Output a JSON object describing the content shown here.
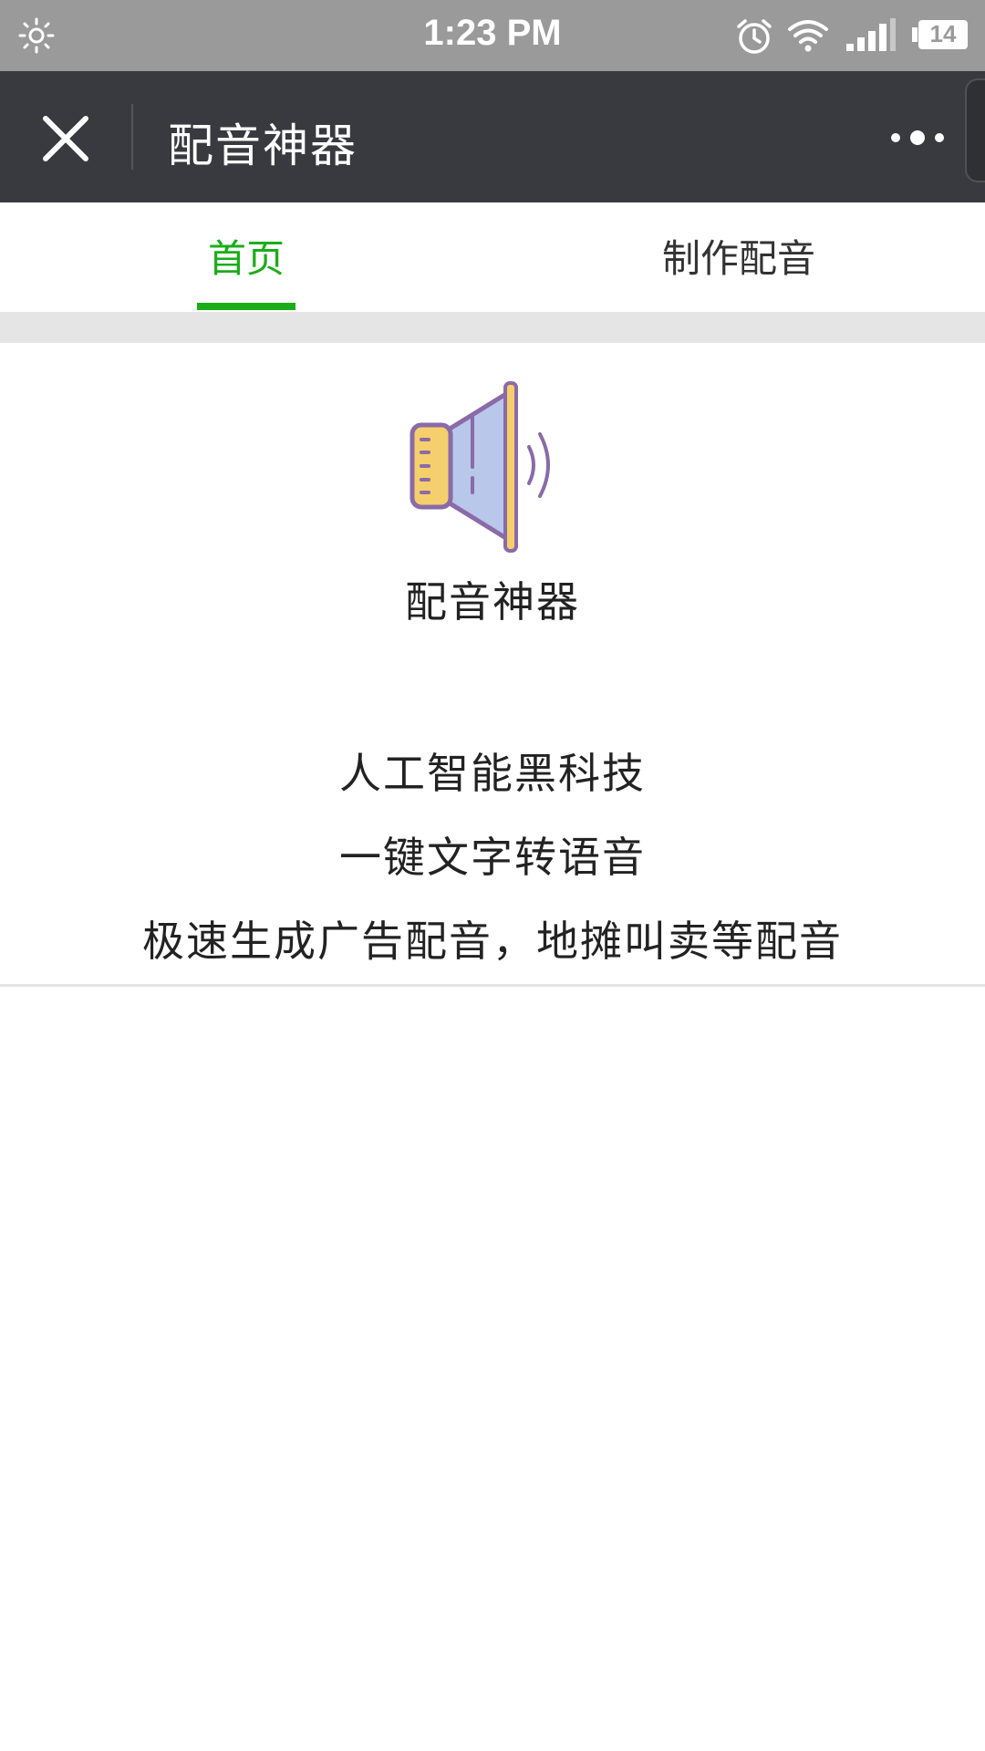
{
  "status_bar": {
    "time": "1:23 PM",
    "battery_level": "14",
    "icons": [
      "brightness-icon",
      "alarm-icon",
      "wifi-icon",
      "signal-icon",
      "battery-icon"
    ]
  },
  "nav": {
    "title": "配音神器",
    "close_icon": "close-icon",
    "more_icon": "more-icon"
  },
  "tabs": [
    {
      "label": "首页",
      "active": true
    },
    {
      "label": "制作配音",
      "active": false
    }
  ],
  "hero": {
    "icon": "speaker-icon",
    "app_name": "配音神器",
    "lines": [
      "人工智能黑科技",
      "一键文字转语音",
      "极速生成广告配音，地摊叫卖等配音"
    ]
  },
  "colors": {
    "accent": "#1aad19",
    "nav_bg": "#393a3f",
    "status_bg": "#9a9a9a"
  }
}
